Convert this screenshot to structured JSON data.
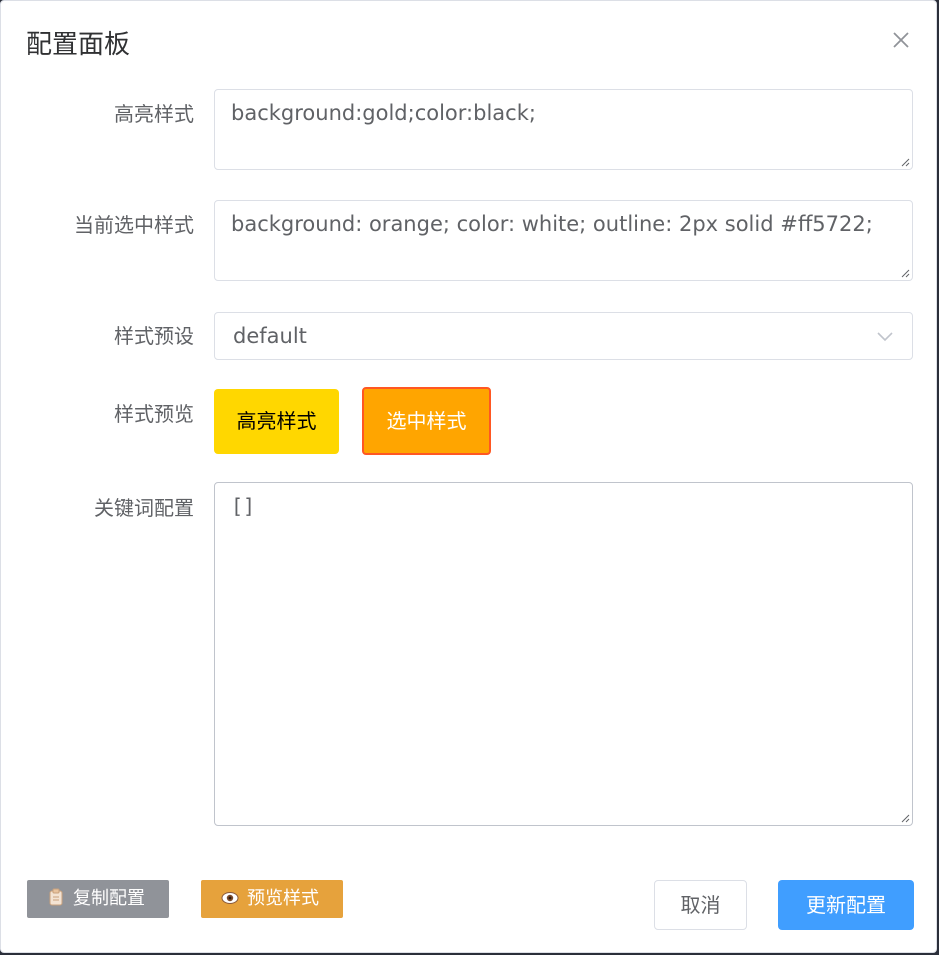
{
  "dialog": {
    "title": "配置面板"
  },
  "form": {
    "highlight_style": {
      "label": "高亮样式",
      "value": "background:gold;color:black;"
    },
    "selected_style": {
      "label": "当前选中样式",
      "value": "background: orange; color: white; outline: 2px solid #ff5722;"
    },
    "style_preset": {
      "label": "样式预设",
      "value": "default"
    },
    "style_preview": {
      "label": "样式预览",
      "highlight_sample": "高亮样式",
      "selected_sample": "选中样式"
    },
    "keywords": {
      "label": "关键词配置",
      "value": "[]"
    }
  },
  "footer": {
    "copy_label": "复制配置",
    "preview_label": "预览样式",
    "cancel_label": "取消",
    "update_label": "更新配置"
  },
  "icons": {
    "close": "close-icon",
    "copy": "clipboard-icon",
    "preview": "eye-icon",
    "select_arrow": "chevron-down-icon"
  }
}
